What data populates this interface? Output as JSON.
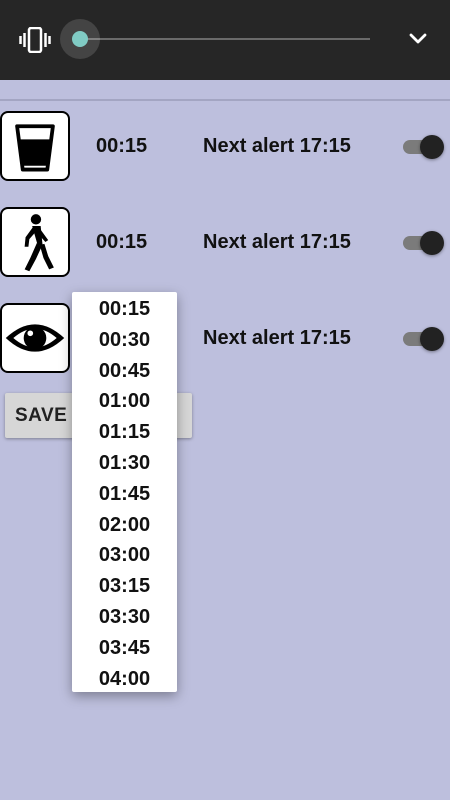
{
  "colors": {
    "background": "#bdbfdd",
    "topbar": "#262626",
    "slider_thumb": "#80cbc4",
    "switch_thumb": "#222222"
  },
  "topbar": {
    "vibrate_icon": "vibrate-icon",
    "volume_slider_level": 0,
    "expand_icon": "chevron-down-icon"
  },
  "rows": [
    {
      "icon": "water-glass-icon",
      "interval": "00:15",
      "next_alert": "Next alert 17:15",
      "enabled": true
    },
    {
      "icon": "walking-person-icon",
      "interval": "00:15",
      "next_alert": "Next alert 17:15",
      "enabled": true
    },
    {
      "icon": "eye-icon",
      "interval": "",
      "next_alert": "Next alert 17:15",
      "enabled": true
    }
  ],
  "save_button": {
    "label": "SAVE SETTINGS"
  },
  "dropdown": {
    "options": [
      "00:15",
      "00:30",
      "00:45",
      "01:00",
      "01:15",
      "01:30",
      "01:45",
      "02:00",
      "03:00",
      "03:15",
      "03:30",
      "03:45",
      "04:00"
    ]
  }
}
